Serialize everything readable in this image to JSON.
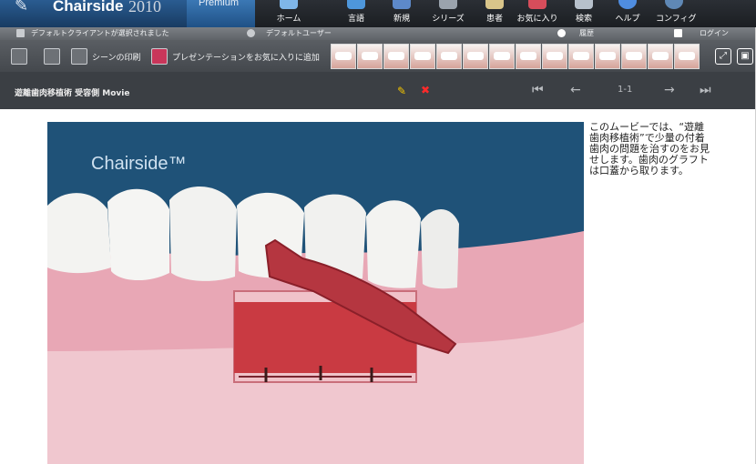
{
  "app": {
    "name": "Chairside",
    "year": "2010",
    "edition": "Premium"
  },
  "nav": [
    {
      "label": "ホーム",
      "icon": "home-icon",
      "color": "#7fb6e8"
    },
    {
      "label": "言語",
      "icon": "language-icon",
      "color": "#4e97db"
    },
    {
      "label": "新規",
      "icon": "new-icon",
      "color": "#5d89c9"
    },
    {
      "label": "シリーズ",
      "icon": "series-icon",
      "color": "#9aa3ad"
    },
    {
      "label": "患者",
      "icon": "patient-icon",
      "color": "#d9c58a"
    },
    {
      "label": "お気に入り",
      "icon": "favorites-icon",
      "color": "#d74d5b"
    },
    {
      "label": "検索",
      "icon": "search-icon",
      "color": "#b7c1cc"
    },
    {
      "label": "ヘルプ",
      "icon": "help-icon",
      "color": "#4f8de0"
    },
    {
      "label": "コンフィグ",
      "icon": "config-icon",
      "color": "#5f88b5"
    }
  ],
  "status": {
    "client": "デフォルトクライアントが選択されました",
    "user": "デフォルトユーザー",
    "history": "履歴",
    "login": "ログイン"
  },
  "toolbar": {
    "print": "シーンの印刷",
    "add_favorite": "プレゼンテーションをお気に入りに追加"
  },
  "movie": {
    "title": "遊離歯肉移植術  受容側  Movie",
    "pager": "1-1"
  },
  "video": {
    "watermark": "Chairside™"
  },
  "description": "このムービーでは、“遊離歯肉移植術”で少量の付着歯肉の問題を治すのをお見せします。歯肉のグラフトは口蓋から取ります。"
}
